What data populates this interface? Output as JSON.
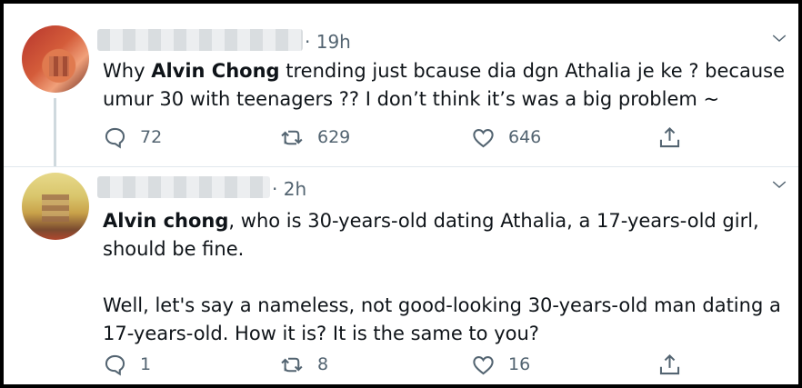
{
  "tweets": [
    {
      "time": "· 19h",
      "text_bold": "Alvin Chong",
      "text_before": "Why ",
      "text_after": " trending just bcause dia dgn Athalia je ke ? because umur 30 with teenagers ?? I don’t think it’s was a big problem ~",
      "replies": "72",
      "retweets": "629",
      "likes": "646"
    },
    {
      "time": "· 2h",
      "text_bold": "Alvin chong",
      "text_after": ", who is 30-years-old dating Athalia, a 17-years-old girl, should be fine.\n\nWell, let's say a nameless, not good-looking 30-years-old man dating a 17-years-old. How it is? It is the same to you?",
      "replies": "1",
      "retweets": "8",
      "likes": "16"
    }
  ],
  "icons": {
    "reply": "speech-bubble-icon",
    "retweet": "retweet-arrows-icon",
    "like": "heart-icon",
    "share": "share-upload-icon",
    "more": "chevron-down-icon"
  },
  "colors": {
    "muted": "#536471",
    "text": "#0f1419",
    "divider": "#e1e8ed",
    "border": "#000000"
  }
}
